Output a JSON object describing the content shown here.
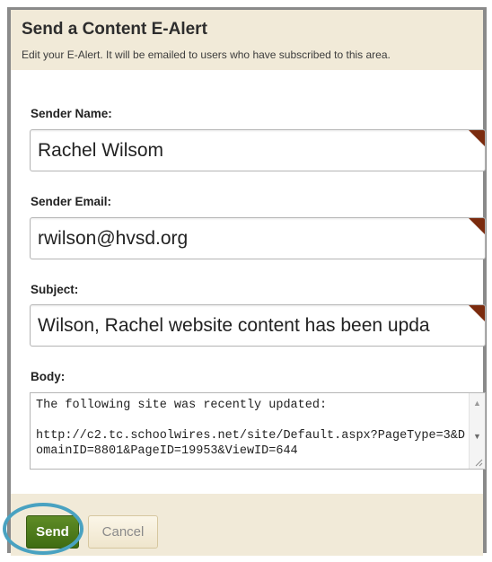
{
  "header": {
    "title": "Send a Content E-Alert",
    "subtitle": "Edit your E-Alert. It will be emailed to users who have subscribed to this area."
  },
  "form": {
    "sender_name_label": "Sender Name:",
    "sender_name_value": "Rachel Wilsom",
    "sender_email_label": "Sender Email:",
    "sender_email_value": "rwilson@hvsd.org",
    "subject_label": "Subject:",
    "subject_value": "Wilson, Rachel website content has been upda",
    "body_label": "Body:",
    "body_text": "The following site was recently updated:\n\nhttp://c2.tc.schoolwires.net/site/Default.aspx?PageType=3&DomainID=8801&PageID=19953&ViewID=644"
  },
  "footer": {
    "send_label": "Send",
    "cancel_label": "Cancel"
  },
  "colors": {
    "header_bg": "#f1ead8",
    "send_button": "#4a7a1a",
    "required_marker": "#7b2b0e",
    "highlight_ring": "#49a2c1"
  },
  "icons": {
    "required": "required-field-marker-icon",
    "scroll_up": "scroll-up-arrow-icon",
    "scroll_down": "scroll-down-arrow-icon",
    "resize": "resize-grip-icon"
  }
}
